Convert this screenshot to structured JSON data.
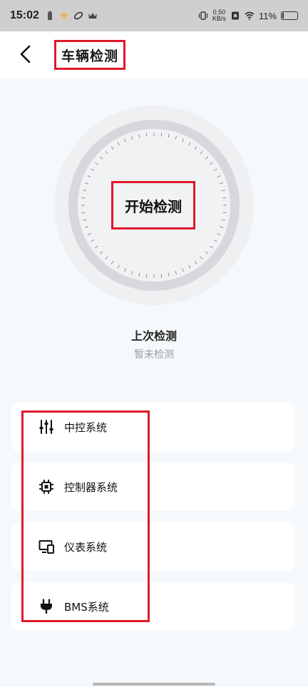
{
  "status_bar": {
    "time": "15:02",
    "net_speed_value": "0.50",
    "net_speed_unit": "KB/s",
    "battery_percent": "11%",
    "battery_level": 0.11
  },
  "header": {
    "title": "车辆检测"
  },
  "dial": {
    "button_label": "开始检测"
  },
  "last_check": {
    "title": "上次检测",
    "value": "暂未检测"
  },
  "systems": [
    {
      "label": "中控系统",
      "icon": "sliders-icon"
    },
    {
      "label": "控制器系统",
      "icon": "chip-icon"
    },
    {
      "label": "仪表系统",
      "icon": "monitor-icon"
    },
    {
      "label": "BMS系统",
      "icon": "plug-icon"
    }
  ],
  "colors": {
    "highlight": "#e0192b",
    "background": "#f6f9fc",
    "dial_outer": "#eef0f2",
    "dial_ring": "#d6d8db",
    "dial_inner": "#f1f2f4"
  }
}
